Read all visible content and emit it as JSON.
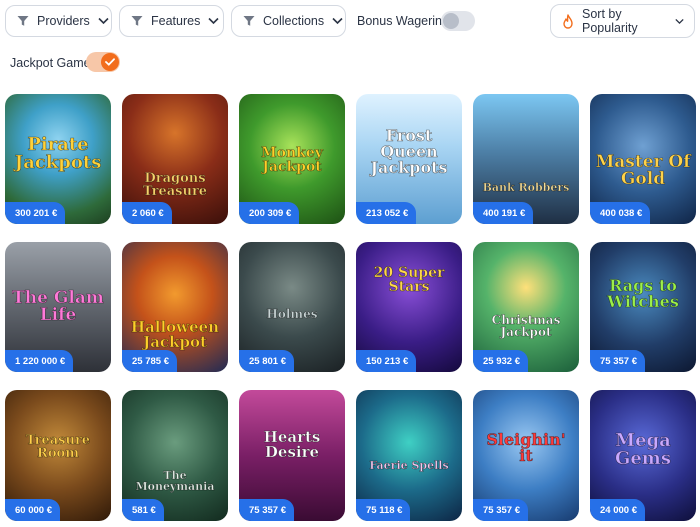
{
  "filters": {
    "providers": "Providers",
    "features": "Features",
    "collections": "Collections",
    "bonus_wagering": "Bonus Wagering",
    "sort": "Sort by Popularity",
    "jackpot_games": "Jackpot Games"
  },
  "games": [
    {
      "title": "Pirate Jackpots",
      "jackpot": "300 201 €"
    },
    {
      "title": "Dragons Treasure",
      "jackpot": "2 060 €"
    },
    {
      "title": "Monkey Jackpot",
      "jackpot": "200 309 €"
    },
    {
      "title": "Frost Queen Jackpots",
      "jackpot": "213 052 €"
    },
    {
      "title": "Bank Robbers",
      "jackpot": "400 191 €"
    },
    {
      "title": "Master Of Gold",
      "jackpot": "400 038 €"
    },
    {
      "title": "The Glam Life",
      "jackpot": "1 220 000 €"
    },
    {
      "title": "Halloween Jackpot",
      "jackpot": "25 785 €"
    },
    {
      "title": "Holmes",
      "jackpot": "25 801 €"
    },
    {
      "title": "20 Super Stars",
      "jackpot": "150 213 €"
    },
    {
      "title": "Christmas Jackpot",
      "jackpot": "25 932 €"
    },
    {
      "title": "Rags to Witches",
      "jackpot": "75 357 €"
    },
    {
      "title": "Treasure Room",
      "jackpot": "60 000 €"
    },
    {
      "title": "The Moneymania",
      "jackpot": "581 €"
    },
    {
      "title": "Hearts Desire",
      "jackpot": "75 357 €"
    },
    {
      "title": "Faerie Spells",
      "jackpot": "75 118 €"
    },
    {
      "title": "Sleighin' it",
      "jackpot": "75 357 €"
    },
    {
      "title": "Mega Gems",
      "jackpot": "24 000 €"
    }
  ],
  "colors": {
    "accent": "#f26d1c",
    "jackpot_badge": "#2670e8",
    "border": "#d4d9e1"
  },
  "icons": {
    "filter": "funnel-icon",
    "dropdown": "chevron-down-icon",
    "sort": "flame-icon",
    "toggle_on": "check-icon"
  }
}
